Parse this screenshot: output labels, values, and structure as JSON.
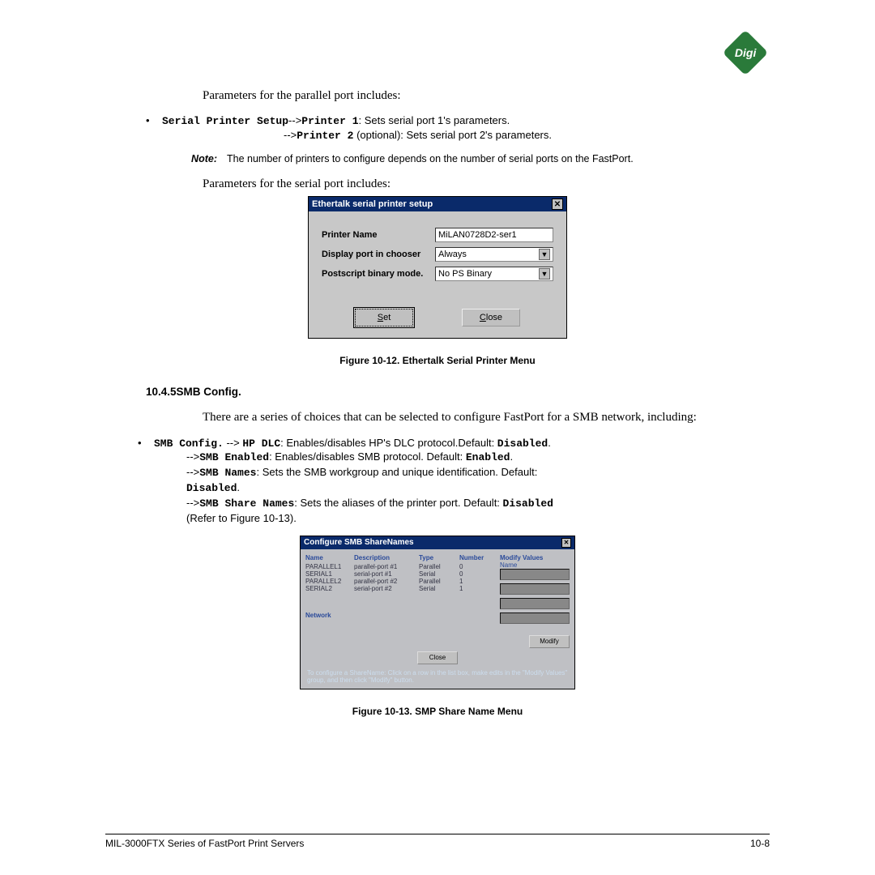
{
  "logo_text": "Digi",
  "para_parallel": "Parameters for the parallel port includes:",
  "bullet1_prefix": "Serial Printer Setup",
  "bullet1_arrow": "-->",
  "bullet1_code": "Printer 1",
  "bullet1_rest": ": Sets serial port 1's parameters.",
  "bullet1_sub_arrow": "-->",
  "bullet1_sub_code": "Printer 2",
  "bullet1_sub_rest": " (optional): Sets serial port 2's parameters.",
  "note_label": "Note:",
  "note_text": "The number of printers to configure depends on the number of serial ports on the FastPort.",
  "para_serial": "Parameters for the serial port includes:",
  "dialog1": {
    "title": "Ethertalk serial printer setup",
    "rows": [
      {
        "label": "Printer Name",
        "value": "MiLAN0728D2-ser1",
        "type": "text"
      },
      {
        "label": "Display port in chooser",
        "value": "Always",
        "type": "select"
      },
      {
        "label": "Postscript binary mode.",
        "value": "No PS Binary",
        "type": "select"
      }
    ],
    "btn_set": "Set",
    "btn_close": "Close"
  },
  "fig12": "Figure 10-12. Ethertalk Serial Printer Menu",
  "section_num": "10.4.5",
  "section_title": "SMB Config.",
  "smb_intro": "There are a series of choices that can be selected to configure FastPort for a SMB network, including:",
  "smb_bullet_code": "SMB Config.",
  "smb_bullet_arrow": " --> ",
  "smb_bullet_code2": "HP DLC",
  "smb_bullet_rest": ": Enables/disables HP's DLC protocol.Default: ",
  "smb_bullet_def": "Disabled",
  "smb_lines": [
    {
      "arrow": "-->",
      "code": "SMB Enabled",
      "rest": ": Enables/disables SMB protocol. Default: ",
      "def": "Enabled",
      "tail": "."
    },
    {
      "arrow": "-->",
      "code": "SMB Names",
      "rest": ": Sets the SMB workgroup and unique identification. Default: ",
      "def": "Disabled",
      "tail": "."
    },
    {
      "arrow": "-->",
      "code": "SMB Share Names",
      "rest": ": Sets the aliases of the printer port. Default: ",
      "def": "Disabled",
      "tail": " (Refer to Figure 10-13)."
    }
  ],
  "dialog2": {
    "title": "Configure SMB ShareNames",
    "headers": [
      "Name",
      "Description",
      "Type",
      "Number",
      "Modify Values"
    ],
    "rows": [
      [
        "PARALLEL1",
        "parallel-port #1",
        "Parallel",
        "0"
      ],
      [
        "SERIAL1",
        "serial-port #1",
        "Serial",
        "0"
      ],
      [
        "PARALLEL2",
        "parallel-port #2",
        "Parallel",
        "1"
      ],
      [
        "SERIAL2",
        "serial-port #2",
        "Serial",
        "1"
      ]
    ],
    "right_label": "Name",
    "network_label": "Network",
    "btn_close": "Close",
    "btn_modify": "Modify",
    "footnote": "To configure a ShareName: Click on a row in the list box, make edits in the \"Modify Values\" group, and then click \"Modify\" button."
  },
  "fig13": "Figure 10-13. SMP Share Name Menu",
  "footer_left": "MIL-3000FTX Series of FastPort Print Servers",
  "footer_right": "10-8"
}
